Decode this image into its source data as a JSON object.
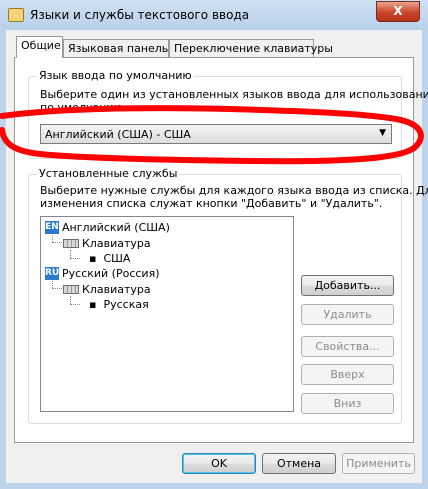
{
  "window": {
    "title": "Языки и службы текстового ввода",
    "close_label": "X"
  },
  "tabs": [
    {
      "label": "Общие",
      "active": true
    },
    {
      "label": "Языковая панель",
      "active": false
    },
    {
      "label": "Переключение клавиатуры",
      "active": false
    }
  ],
  "default_language": {
    "group_title": "Язык ввода по умолчанию",
    "description_line1": "Выберите один из установленных языков ввода для использования",
    "description_line2": "по умолчанию.",
    "selected": "Английский (США) - США"
  },
  "installed_services": {
    "group_title": "Установленные службы",
    "description_line1": "Выберите нужные службы для каждого языка ввода из списка. Для",
    "description_line2": "изменения списка служат кнопки \"Добавить\" и \"Удалить\".",
    "tree": [
      {
        "badge": "EN",
        "language": "Английский (США)",
        "category": "Клавиатура",
        "layout": "США"
      },
      {
        "badge": "RU",
        "language": "Русский (Россия)",
        "category": "Клавиатура",
        "layout": "Русская"
      }
    ],
    "buttons": {
      "add": "Добавить...",
      "remove": "Удалить",
      "properties": "Свойства...",
      "up": "Вверх",
      "down": "Вниз"
    }
  },
  "footer": {
    "ok": "OK",
    "cancel": "Отмена",
    "apply": "Применить"
  },
  "colors": {
    "annotation_stroke": "#ff0000",
    "language_badge": "#2a7bd0"
  }
}
